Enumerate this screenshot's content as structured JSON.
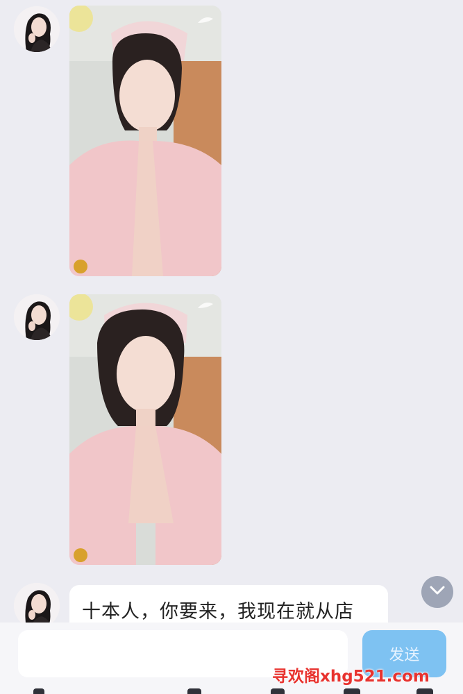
{
  "messages": [
    {
      "type": "image",
      "sender": "contact",
      "image": "nurse-selfie-photo"
    },
    {
      "type": "image",
      "sender": "contact",
      "image": "nurse-selfie-photo"
    },
    {
      "type": "text",
      "sender": "contact",
      "text": "十本人，你要来，我现在就从店"
    }
  ],
  "input": {
    "value": "",
    "placeholder": ""
  },
  "send_button": {
    "label": "发送",
    "color": "#7ec2f2"
  },
  "watermark": {
    "text": "寻欢阁xhg521.com",
    "color": "#e8322e"
  },
  "icons": {
    "scroll_down": "chevron-down-icon"
  },
  "colors": {
    "background": "#ececf2",
    "bubble": "#ffffff"
  }
}
